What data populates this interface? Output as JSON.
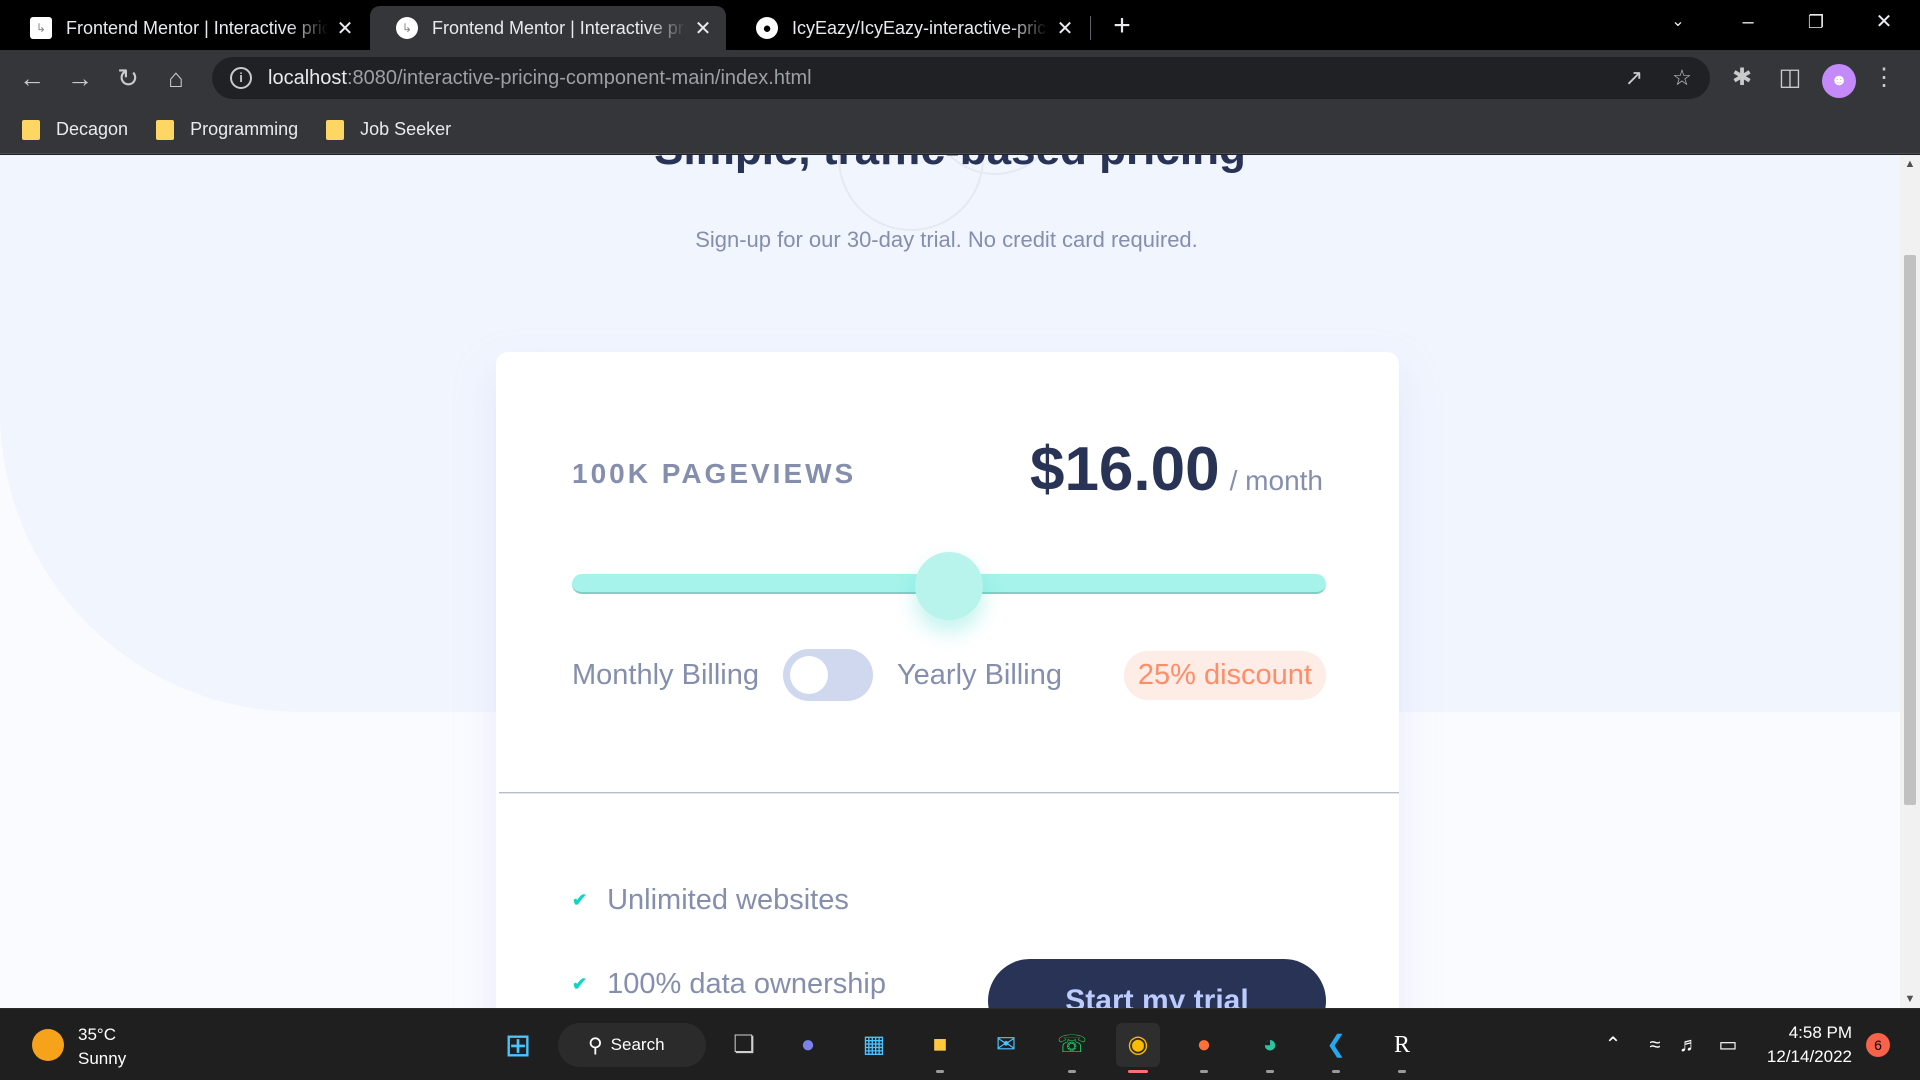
{
  "browser": {
    "tabs": [
      {
        "title": "Frontend Mentor | Interactive pricing component",
        "active": false
      },
      {
        "title": "Frontend Mentor | Interactive pricing component",
        "active": true
      },
      {
        "title": "IcyEazy/IcyEazy-interactive-pricing-component",
        "active": false
      }
    ],
    "new_tab": "+",
    "url_host": "localhost",
    "url_path": ":8080/interactive-pricing-component-main/index.html",
    "bookmarks": [
      "Decagon",
      "Programming",
      "Job Seeker"
    ]
  },
  "page": {
    "headline": "Simple, traffic-based pricing",
    "subtitle": "Sign-up for our 30-day trial. No credit card required.",
    "pageviews": "100K  PAGEVIEWS",
    "price": "$16.00",
    "per": "/ month",
    "slider_value": 0.5,
    "billing_monthly": "Monthly Billing",
    "billing_yearly": "Yearly Billing",
    "discount": "25% discount",
    "features": [
      "Unlimited websites",
      "100% data ownership"
    ],
    "cta": "Start my trial",
    "colors": {
      "accent": "#10d5c2",
      "navy": "#293356",
      "discount": "#ff8d68"
    }
  },
  "taskbar": {
    "temperature": "35°C",
    "condition": "Sunny",
    "search": "Search",
    "time": "4:58 PM",
    "date": "12/14/2022",
    "notifications": "6"
  }
}
